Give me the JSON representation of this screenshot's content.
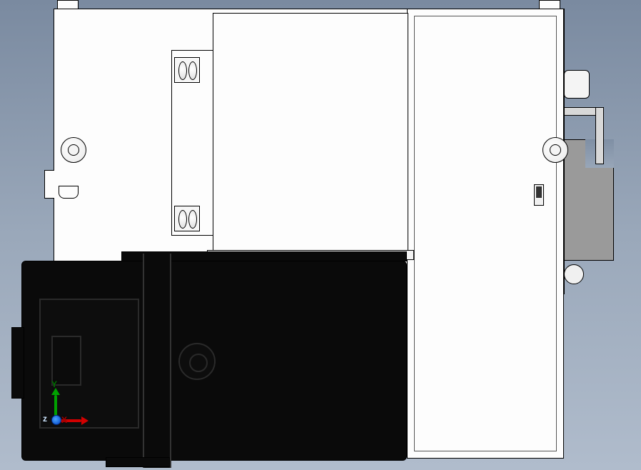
{
  "view": {
    "triad": {
      "x_label": "X",
      "y_label": "Y",
      "z_label": "z"
    },
    "colors": {
      "axis_x": "#d20000",
      "axis_y": "#00a000",
      "axis_z": "#0040c0",
      "model_body": "#fdfdfd",
      "motor": "#0a0a0a",
      "bracket": "#9a9a9a"
    }
  },
  "icons": {
    "triad": "coordinate-triad-icon"
  }
}
